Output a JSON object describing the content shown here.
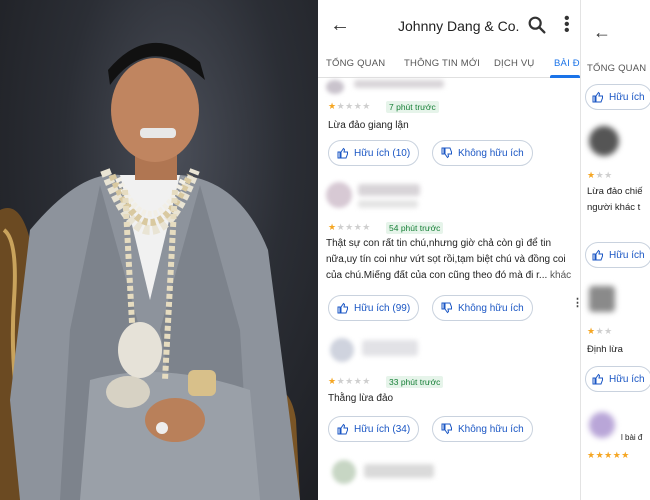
{
  "app": {
    "title": "Johnny Dang & Co.",
    "back_icon": "arrow-left-icon",
    "search_icon": "search-icon",
    "more_icon": "more-vert-icon"
  },
  "tabs": [
    {
      "label": "TỔNG QUAN",
      "active": false
    },
    {
      "label": "THÔNG TIN MỚI",
      "active": false
    },
    {
      "label": "DỊCH VỤ",
      "active": false
    },
    {
      "label": "BÀI ĐĂ",
      "active": true
    }
  ],
  "reviews": [
    {
      "rating": 1,
      "time": "7 phút trước",
      "text": "Lừa đảo giang lận",
      "helpful": "Hữu ích (10)",
      "not_helpful": "Không hữu ích"
    },
    {
      "rating": 1,
      "time": "54 phút trước",
      "text": "Thật sự con rất tin chú,nhưng giờ chả còn gì để tin nữa,uy tín coi như vứt sọt rồi,tạm biệt chú và đồng coi của chú.Miếng đất của con cũng theo đó mà đi r...",
      "more": "khác",
      "helpful": "Hữu ích (99)",
      "not_helpful": "Không hữu ích"
    },
    {
      "rating": 1,
      "time": "33 phút trước",
      "text": "Thằng lừa đảo",
      "helpful": "Hữu ích (34)",
      "not_helpful": "Không hữu ích"
    }
  ],
  "side": {
    "tab": "TỔNG QUAN",
    "helpful": "Hữu ích",
    "text_1": "Lừa đảo chiế",
    "text_2": "người khác t",
    "text_3": "Định lừa",
    "text_4": "l bài đ"
  },
  "colors": {
    "accent": "#1a73e8",
    "star": "#f5a623",
    "time_green": "#188038"
  }
}
